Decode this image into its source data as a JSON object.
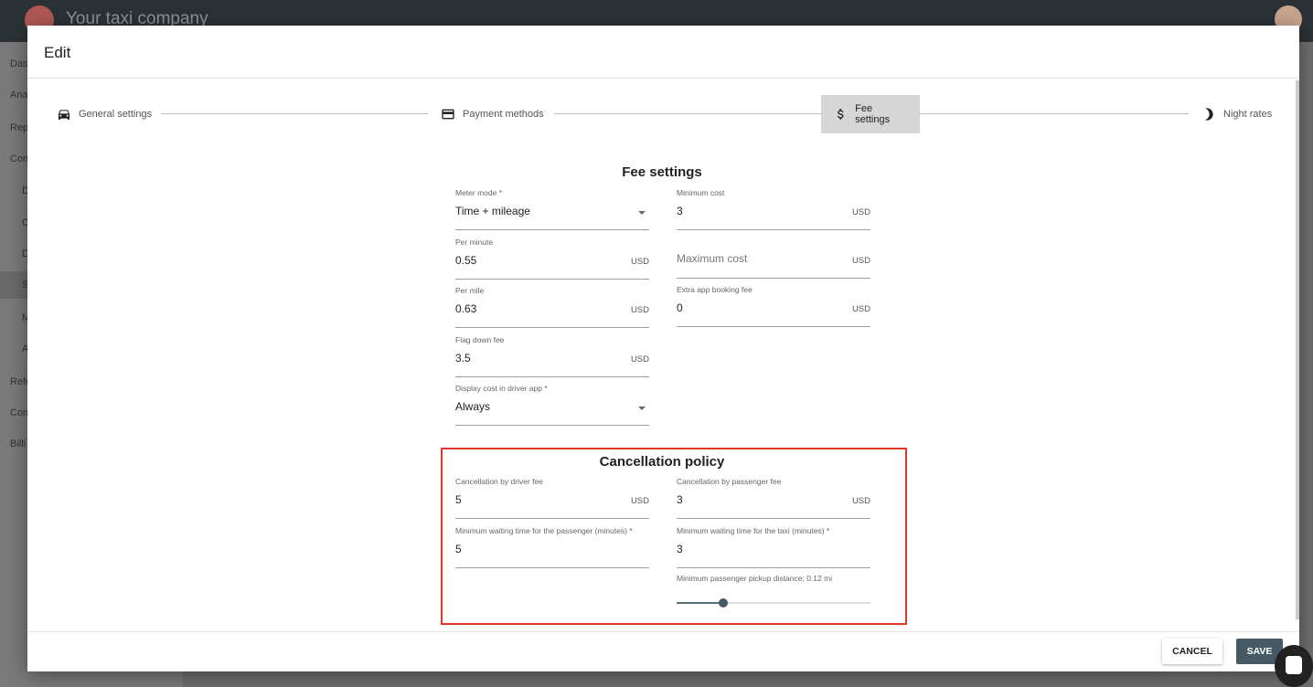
{
  "app": {
    "title": "Your taxi company"
  },
  "sidebar": {
    "items": [
      "Das",
      "Ana",
      "Rep",
      "Com",
      "D",
      "O",
      "D",
      "S",
      "M",
      "A",
      "Refe",
      "Com",
      "Billi"
    ],
    "selected_index": 7
  },
  "dialog": {
    "title": "Edit",
    "steps": [
      {
        "label": "General settings",
        "icon": "car-icon"
      },
      {
        "label": "Payment methods",
        "icon": "credit-card-icon"
      },
      {
        "label": "Fee settings",
        "icon": "dollar-icon",
        "active": true
      },
      {
        "label": "Night rates",
        "icon": "moon-icon"
      }
    ],
    "fee": {
      "title": "Fee settings",
      "meter_mode": {
        "label": "Meter mode *",
        "value": "Time + mileage"
      },
      "per_minute": {
        "label": "Per minute",
        "value": "0.55",
        "unit": "USD"
      },
      "per_mile": {
        "label": "Per mile",
        "value": "0.63",
        "unit": "USD"
      },
      "flag_down": {
        "label": "Flag down fee",
        "value": "3.5",
        "unit": "USD"
      },
      "display_cost": {
        "label": "Display cost in driver app *",
        "value": "Always"
      },
      "minimum_cost": {
        "label": "Minimum cost",
        "value": "3",
        "unit": "USD"
      },
      "maximum_cost": {
        "placeholder": "Maximum cost",
        "unit": "USD"
      },
      "extra_booking": {
        "label": "Extra app booking fee",
        "value": "0",
        "unit": "USD"
      }
    },
    "cancel": {
      "title": "Cancellation policy",
      "driver_fee": {
        "label": "Cancellation by driver fee",
        "value": "5",
        "unit": "USD"
      },
      "passenger_fee": {
        "label": "Cancellation by passenger fee",
        "value": "3",
        "unit": "USD"
      },
      "wait_passenger": {
        "label": "Minimum waiting time for the passenger (minutes) *",
        "value": "5"
      },
      "wait_taxi": {
        "label": "Minimum waiting time for the taxi (minutes) *",
        "value": "3"
      },
      "pickup_distance": {
        "label": "Minimum passenger pickup distance: 0.12 mi",
        "fraction": 0.24
      }
    },
    "buttons": {
      "cancel": "CANCEL",
      "save": "SAVE"
    }
  },
  "colors": {
    "accent": "#455a64",
    "highlight": "#e0362c"
  }
}
